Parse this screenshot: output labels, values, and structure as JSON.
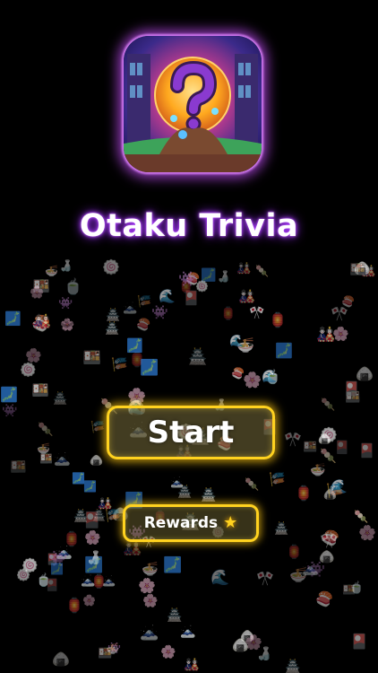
{
  "app": {
    "title": "Otaku Trivia"
  },
  "buttons": {
    "start_label": "Start",
    "rewards_label": "Rewards",
    "rewards_icon": "star-icon"
  },
  "background": {
    "color": "#000000",
    "decoration": "scattered Japanese-themed emoji stickers",
    "stickers": [
      "🎎",
      "🍙",
      "🏯",
      "🌸",
      "🍡",
      "🏮",
      "🗾",
      "🍣",
      "🍱",
      "🍥",
      "🎏",
      "👾",
      "🍶",
      "🗻",
      "🎌",
      "🍜",
      "🕹",
      "🎴",
      "🍵",
      "🌊"
    ]
  },
  "colors": {
    "title_glow": "#b040ff",
    "button_border": "#ffd21f",
    "icon_glow": "#c850ff"
  }
}
